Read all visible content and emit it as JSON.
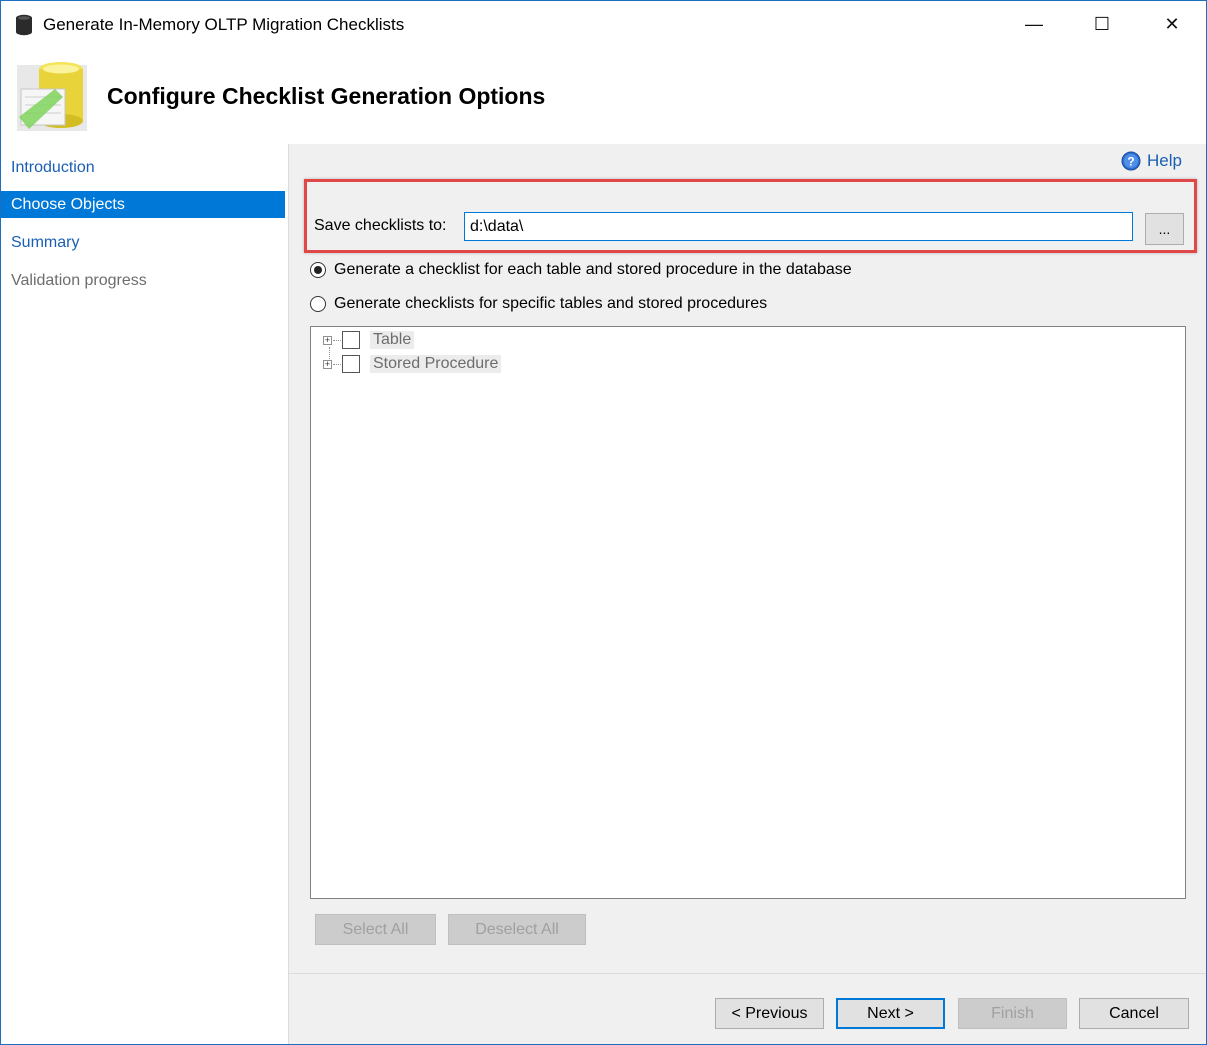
{
  "window": {
    "title": "Generate In-Memory OLTP Migration Checklists",
    "controls": {
      "minimize": "—",
      "maximize": "☐",
      "close": "✕"
    }
  },
  "header": {
    "title": "Configure Checklist Generation Options"
  },
  "sidebar": {
    "items": [
      {
        "label": "Introduction",
        "state": "link"
      },
      {
        "label": "Choose Objects",
        "state": "active"
      },
      {
        "label": "Summary",
        "state": "link"
      },
      {
        "label": "Validation progress",
        "state": "disabled"
      }
    ]
  },
  "help": {
    "label": "Help",
    "icon": "help-circle-icon"
  },
  "save": {
    "label": "Save checklists to:",
    "value": "d:\\data\\",
    "browse_label": "..."
  },
  "options": {
    "all_label": "Generate a checklist for each table and stored procedure in the database",
    "specific_label": "Generate checklists for specific tables and stored procedures",
    "selected": "all"
  },
  "tree": {
    "items": [
      {
        "label": "Table"
      },
      {
        "label": "Stored Procedure"
      }
    ]
  },
  "selection_buttons": {
    "select_all": "Select All",
    "deselect_all": "Deselect All"
  },
  "footer": {
    "previous": "< Previous",
    "next": "Next >",
    "finish": "Finish",
    "cancel": "Cancel"
  },
  "colors": {
    "accent": "#0078d7",
    "highlight_box": "#e04848",
    "link": "#1a5fb4"
  }
}
